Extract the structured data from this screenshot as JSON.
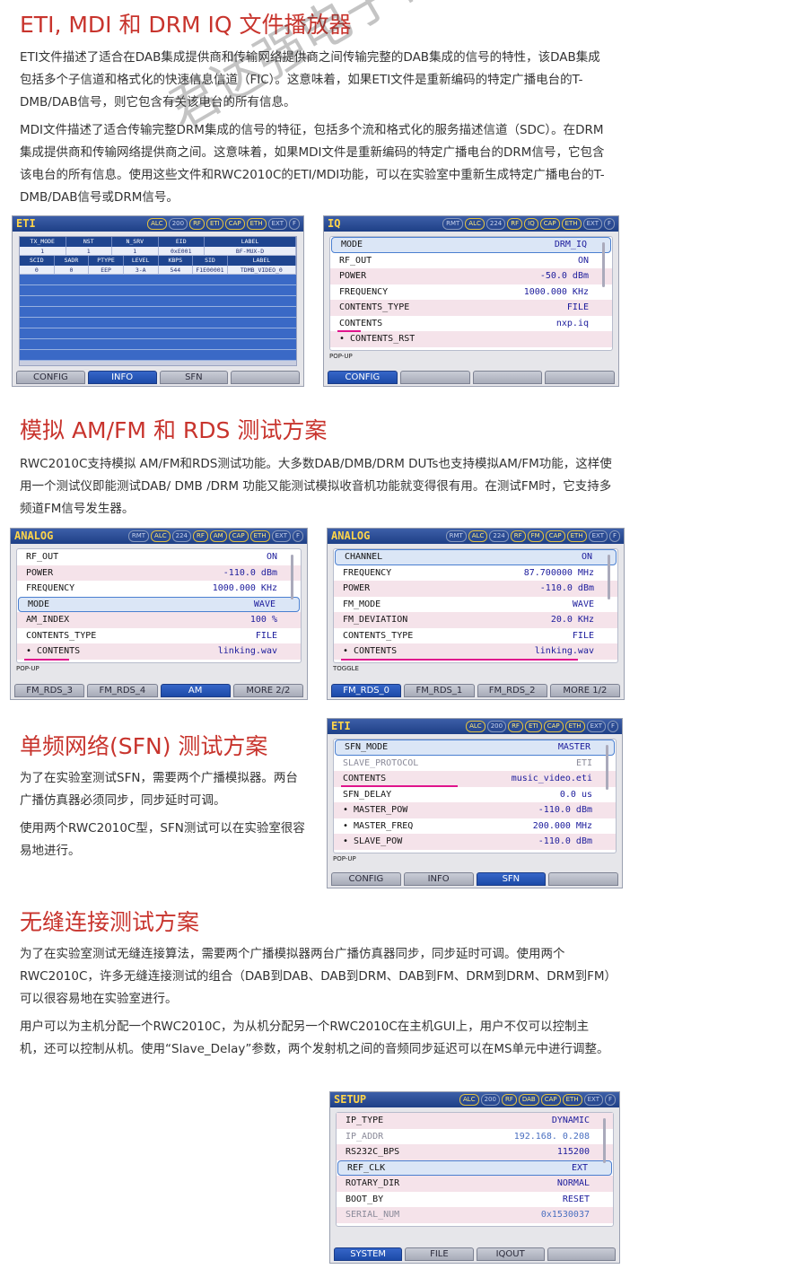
{
  "sections": {
    "eti": {
      "title": "ETI, MDI 和 DRM IQ 文件播放器",
      "p1": "ETI文件描述了适合在DAB集成提供商和传输网络提供商之间传输完整的DAB集成的信号的特性，该DAB集成包括多个子信道和格式化的快速信息信道（FIC）。这意味着，如果ETI文件是重新编码的特定广播电台的T-DMB/DAB信号，则它包含有关该电台的所有信息。",
      "p2": "MDI文件描述了适合传输完整DRM集成的信号的特征，包括多个流和格式化的服务描述信道（SDC）。在DRM集成提供商和传输网络提供商之间。这意味着，如果MDI文件是重新编码的特定广播电台的DRM信号，它包含该电台的所有信息。使用这些文件和RWC2010C的ETI/MDI功能，可以在实验室中重新生成特定广播电台的T-DMB/DAB信号或DRM信号。"
    },
    "analog": {
      "title": "模拟 AM/FM 和 RDS 测试方案",
      "p1": "RWC2010C支持模拟 AM/FM和RDS测试功能。大多数DAB/DMB/DRM DUTs也支持模拟AM/FM功能，这样使用一个测试仪即能测试DAB/ DMB /DRM 功能又能测试模拟收音机功能就变得很有用。在测试FM时，它支持多频道FM信号发生器。"
    },
    "sfn": {
      "title": "单频网络(SFN) 测试方案",
      "p1": "为了在实验室测试SFN，需要两个广播模拟器。两台广播仿真器必须同步，同步延时可调。",
      "p2": "使用两个RWC2010C型，SFN测试可以在实验室很容易地进行。"
    },
    "seamless": {
      "title": "无缝连接测试方案",
      "p1": "为了在实验室测试无缝连接算法，需要两个广播模拟器两台广播仿真器同步，同步延时可调。使用两个RWC2010C，许多无缝连接测试的组合（DAB到DAB、DAB到DRM、DAB到FM、DRM到DRM、DRM到FM）可以很容易地在实验室进行。",
      "p2": "用户可以为主机分配一个RWC2010C，为从机分配另一个RWC2010C在主机GUI上，用户不仅可以控制主机，还可以控制从机。使用“Slave_Delay”参数，两个发射机之间的音频同步延迟可以在MS单元中进行调整。"
    }
  },
  "watermark": "君达强电子科技有限公司",
  "screens": {
    "eti_info": {
      "title": "ETI",
      "badges": [
        "ALC",
        "200",
        "RF",
        "ETI",
        "CAP",
        "ETH",
        "EXT",
        "F"
      ],
      "grid_head1": [
        "TX_MODE",
        "NST",
        "N_SRV",
        "EID",
        "LABEL"
      ],
      "grid_val1": [
        "1",
        "1",
        "1",
        "0xE001",
        "BF-MUX-D"
      ],
      "grid_head2": [
        "SCID",
        "SADR",
        "PTYPE",
        "LEVEL",
        "KBPS",
        "SID",
        "LABEL"
      ],
      "grid_val2": [
        "0",
        "0",
        "EEP",
        "3-A",
        "544",
        "F1E00001",
        "TDMB_VIDEO_0"
      ],
      "tabs": [
        "CONFIG",
        "INFO",
        "SFN",
        ""
      ]
    },
    "iq": {
      "title": "IQ",
      "badges": [
        "RMT",
        "ALC",
        "224",
        "RF",
        "IQ",
        "CAP",
        "ETH",
        "EXT",
        "F"
      ],
      "rows": [
        {
          "k": "MODE",
          "v": "DRM_IQ"
        },
        {
          "k": "RF_OUT",
          "v": "ON"
        },
        {
          "k": "POWER",
          "v": "-50.0 dBm"
        },
        {
          "k": "FREQUENCY",
          "v": "1000.000 KHz"
        },
        {
          "k": "CONTENTS_TYPE",
          "v": "FILE"
        },
        {
          "k": "CONTENTS",
          "v": "nxp.iq"
        },
        {
          "k": " • CONTENTS_RST",
          "v": ""
        }
      ],
      "popup": "POP-UP",
      "tabs": [
        "CONFIG",
        "",
        "",
        ""
      ]
    },
    "am": {
      "title": "ANALOG",
      "badges": [
        "RMT",
        "ALC",
        "224",
        "RF",
        "AM",
        "CAP",
        "ETH",
        "EXT",
        "F"
      ],
      "rows": [
        {
          "k": "RF_OUT",
          "v": "ON"
        },
        {
          "k": "POWER",
          "v": "-110.0 dBm"
        },
        {
          "k": "FREQUENCY",
          "v": "1000.000 KHz"
        },
        {
          "k": "MODE",
          "v": "WAVE"
        },
        {
          "k": "AM_INDEX",
          "v": "100 %"
        },
        {
          "k": "CONTENTS_TYPE",
          "v": "FILE"
        },
        {
          "k": " • CONTENTS",
          "v": "linking.wav"
        }
      ],
      "popup": "POP-UP",
      "tabs": [
        "FM_RDS_3",
        "FM_RDS_4",
        "AM",
        "MORE 2/2"
      ]
    },
    "fm": {
      "title": "ANALOG",
      "badges": [
        "RMT",
        "ALC",
        "224",
        "RF",
        "FM",
        "CAP",
        "ETH",
        "EXT",
        "F"
      ],
      "rows": [
        {
          "k": "CHANNEL",
          "v": "ON"
        },
        {
          "k": "FREQUENCY",
          "v": "87.700000 MHz"
        },
        {
          "k": "POWER",
          "v": "-110.0 dBm"
        },
        {
          "k": "FM_MODE",
          "v": "WAVE"
        },
        {
          "k": "FM_DEVIATION",
          "v": "20.0 KHz"
        },
        {
          "k": "CONTENTS_TYPE",
          "v": "FILE"
        },
        {
          "k": " • CONTENTS",
          "v": "linking.wav"
        }
      ],
      "popup": "TOGGLE",
      "tabs": [
        "FM_RDS_0",
        "FM_RDS_1",
        "FM_RDS_2",
        "MORE 1/2"
      ]
    },
    "sfn": {
      "title": "ETI",
      "badges": [
        "ALC",
        "200",
        "RF",
        "ETI",
        "CAP",
        "ETH",
        "EXT",
        "F"
      ],
      "rows": [
        {
          "k": "SFN_MODE",
          "v": "MASTER"
        },
        {
          "k": "SLAVE_PROTOCOL",
          "v": "ETI"
        },
        {
          "k": "CONTENTS",
          "v": "music_video.eti"
        },
        {
          "k": "SFN_DELAY",
          "v": "0.0 us"
        },
        {
          "k": " • MASTER_POW",
          "v": "-110.0 dBm"
        },
        {
          "k": " • MASTER_FREQ",
          "v": "200.000 MHz"
        },
        {
          "k": " • SLAVE_POW",
          "v": "-110.0 dBm"
        }
      ],
      "popup": "POP-UP",
      "tabs": [
        "CONFIG",
        "INFO",
        "SFN",
        ""
      ]
    },
    "setup": {
      "title": "SETUP",
      "badges": [
        "ALC",
        "200",
        "RF",
        "DAB",
        "CAP",
        "ETH",
        "EXT",
        "F"
      ],
      "rows": [
        {
          "k": "IP_TYPE",
          "v": "DYNAMIC"
        },
        {
          "k": "IP_ADDR",
          "v": "192.168.  0.208"
        },
        {
          "k": "RS232C_BPS",
          "v": "115200"
        },
        {
          "k": "REF_CLK",
          "v": "EXT"
        },
        {
          "k": "ROTARY_DIR",
          "v": "NORMAL"
        },
        {
          "k": "BOOT_BY",
          "v": "RESET"
        },
        {
          "k": "SERIAL_NUM",
          "v": "0x1530037"
        }
      ],
      "tabs": [
        "SYSTEM",
        "FILE",
        "IQOUT",
        ""
      ]
    }
  }
}
